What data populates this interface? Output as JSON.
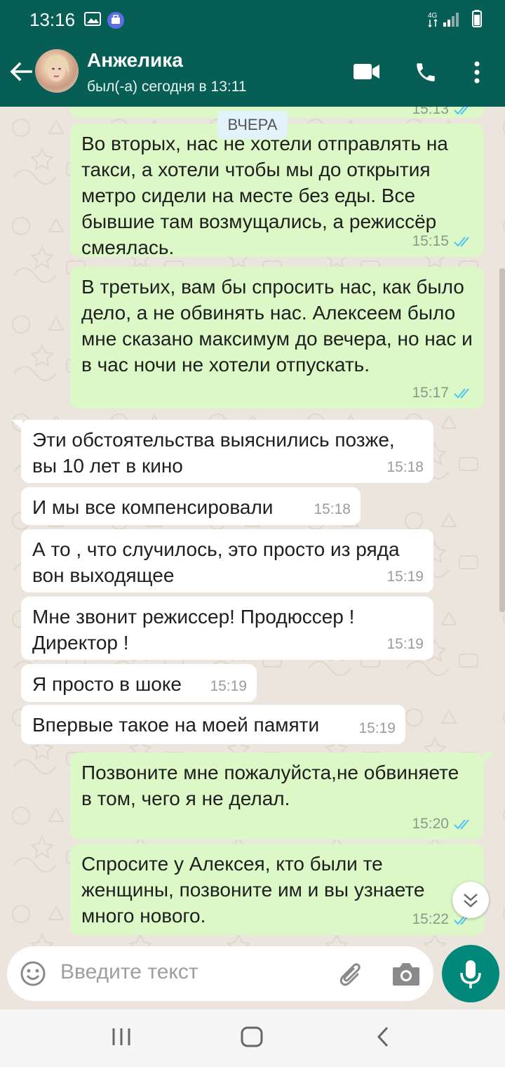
{
  "status_bar": {
    "time": "13:16",
    "network": "4G"
  },
  "header": {
    "contact_name": "Анжелика",
    "contact_status": "был(-а) сегодня в 13:11",
    "icons": [
      "back-arrow-icon",
      "video-call-icon",
      "voice-call-icon",
      "more-options-icon"
    ]
  },
  "chat": {
    "date_divider": "ВЧЕРА",
    "partial_top_time": "15:13",
    "messages": [
      {
        "dir": "out",
        "text": "Во вторых,  нас не хотели отправлять на такси, а хотели чтобы мы до открытия метро сидели на месте без еды. Все бывшие там возмущались,  а режиссёр смеялась.",
        "time": "15:15",
        "status": "read"
      },
      {
        "dir": "out",
        "text": "В третьих, вам бы спросить нас, как было дело,  а не обвинять нас. Алексеем было мне сказано максимум до вечера, но нас и в час ночи не хотели отпускать.",
        "time": "15:17",
        "status": "read"
      },
      {
        "dir": "in",
        "text": "Эти обстоятельства выяснились позже, вы 10 лет в кино",
        "time": "15:18"
      },
      {
        "dir": "in",
        "text": "И мы все компенсировали",
        "time": "15:18"
      },
      {
        "dir": "in",
        "text": "А то , что случилось, это просто из ряда вон выходящее",
        "time": "15:19"
      },
      {
        "dir": "in",
        "text": "Мне звонит режиссер! Продюссер ! Директор !",
        "time": "15:19"
      },
      {
        "dir": "in",
        "text": "Я просто в шоке",
        "time": "15:19"
      },
      {
        "dir": "in",
        "text": "Впервые такое на моей памяти",
        "time": "15:19"
      },
      {
        "dir": "out",
        "text": "Позвоните мне пожалуйста,не обвиняете в том, чего я не делал.",
        "time": "15:20",
        "status": "read"
      },
      {
        "dir": "out",
        "text": "Спросите у Алексея,  кто были те женщины, позвоните им и вы узнаете много нового.",
        "time": "15:22",
        "status": "read"
      }
    ]
  },
  "composer": {
    "placeholder": "Введите текст"
  },
  "colors": {
    "header": "#075e54",
    "outgoing": "#dcf8c6",
    "incoming": "#ffffff",
    "read_ticks": "#4fc3f7",
    "mic": "#00897b"
  }
}
